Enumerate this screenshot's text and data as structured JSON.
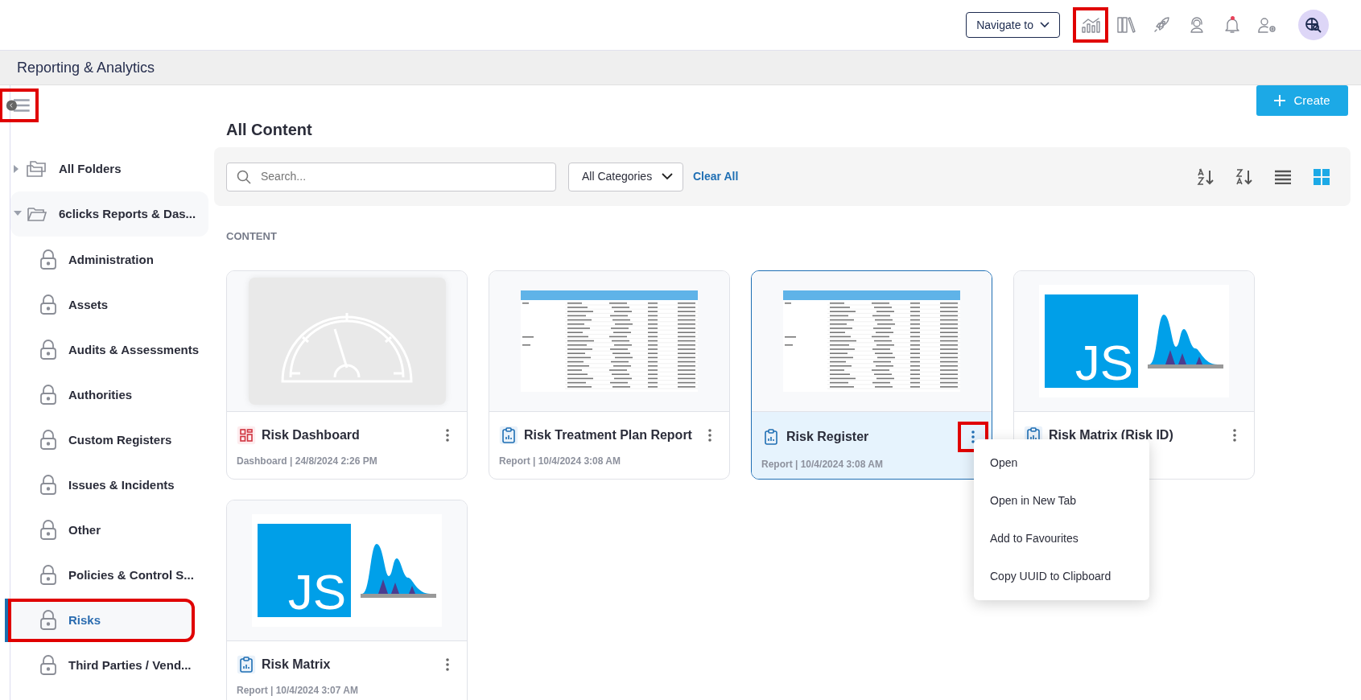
{
  "topbar": {
    "navigate": {
      "label": "Navigate to"
    },
    "icons": [
      {
        "kind": "analytics",
        "highlighted": true,
        "badge": false
      },
      {
        "kind": "library",
        "highlighted": false,
        "badge": false
      },
      {
        "kind": "rocket",
        "highlighted": false,
        "badge": false
      },
      {
        "kind": "support",
        "highlighted": false,
        "badge": false
      },
      {
        "kind": "bell",
        "highlighted": false,
        "badge": true
      },
      {
        "kind": "user_settings",
        "highlighted": false,
        "badge": false
      }
    ]
  },
  "breadcrumb": {
    "title": "Reporting & Analytics"
  },
  "sidebar": {
    "menu_toggle": {
      "highlighted": true
    },
    "tree": [
      {
        "label": "All Folders",
        "expanded": false,
        "selected": false
      },
      {
        "label": "6clicks Reports & Das...",
        "expanded": true,
        "selected": false,
        "children": [
          {
            "label": "Administration",
            "selected": false,
            "highlighted": false
          },
          {
            "label": "Assets",
            "selected": false,
            "highlighted": false
          },
          {
            "label": "Audits & Assessments",
            "selected": false,
            "highlighted": false
          },
          {
            "label": "Authorities",
            "selected": false,
            "highlighted": false
          },
          {
            "label": "Custom Registers",
            "selected": false,
            "highlighted": false
          },
          {
            "label": "Issues & Incidents",
            "selected": false,
            "highlighted": false
          },
          {
            "label": "Other",
            "selected": false,
            "highlighted": false
          },
          {
            "label": "Policies & Control S...",
            "selected": false,
            "highlighted": false
          },
          {
            "label": "Risks",
            "selected": true,
            "highlighted": true
          },
          {
            "label": "Third Parties / Vend...",
            "selected": false,
            "highlighted": false
          }
        ]
      }
    ]
  },
  "main": {
    "create_button": {
      "label": "Create"
    },
    "title": "All Content",
    "filters": {
      "search": {
        "placeholder": "Search..."
      },
      "category": {
        "value": "All Categories"
      },
      "clear": "Clear All",
      "views": [
        {
          "kind": "sort_az",
          "selected": false
        },
        {
          "kind": "sort_za",
          "selected": false
        },
        {
          "kind": "list",
          "selected": false
        },
        {
          "kind": "grid",
          "selected": true
        }
      ]
    },
    "section_label": "CONTENT",
    "cards": [
      {
        "kind": "dashboard",
        "title": "Risk Dashboard",
        "meta": "Dashboard | 24/8/2024 2:26 PM",
        "selected": false,
        "menu_highlighted": false
      },
      {
        "kind": "table",
        "title": "Risk Treatment Plan Report",
        "meta": "Report | 10/4/2024 3:08 AM",
        "selected": false,
        "menu_highlighted": false
      },
      {
        "kind": "table",
        "title": "Risk Register",
        "meta": "Report | 10/4/2024 3:08 AM",
        "selected": true,
        "menu_highlighted": true
      },
      {
        "kind": "chart",
        "title": "Risk Matrix (Risk ID)",
        "logo_text": "JS",
        "selected": false,
        "menu_highlighted": false
      },
      {
        "kind": "chart",
        "title": "Risk Matrix",
        "meta": "Report | 10/4/2024 3:07 AM",
        "logo_text": "JS",
        "selected": false,
        "menu_highlighted": false
      }
    ],
    "context_menu": {
      "items": [
        "Open",
        "Open in New Tab",
        "Add to Favourites",
        "Copy UUID to Clipboard"
      ]
    }
  }
}
